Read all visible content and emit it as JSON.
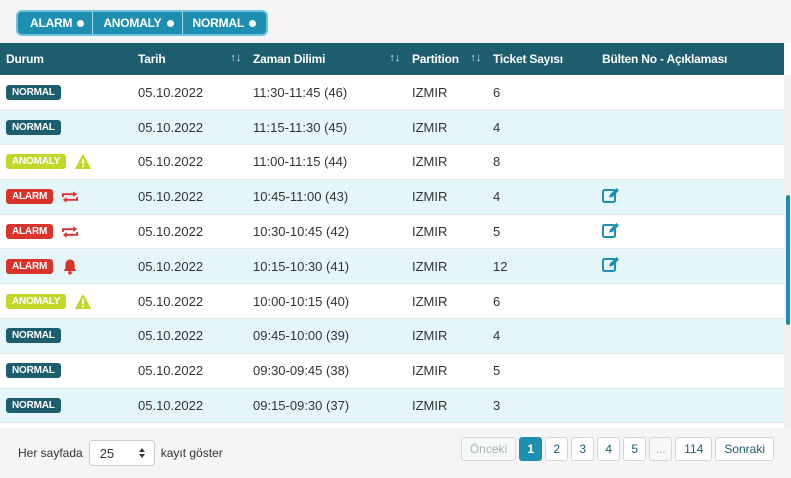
{
  "filters": [
    {
      "label": "ALARM"
    },
    {
      "label": "ANOMALY"
    },
    {
      "label": "NORMAL"
    }
  ],
  "table": {
    "columns": [
      "Durum",
      "Tarih",
      "Zaman Dilimi",
      "Partition",
      "Ticket Sayısı",
      "Bülten No - Açıklaması"
    ],
    "sort_glyph": "↑↓",
    "rows": [
      {
        "status": "NORMAL",
        "status_icon": "",
        "date": "05.10.2022",
        "slot": "11:30-11:45 (46)",
        "partition": "IZMIR",
        "tickets": "6",
        "edit": false
      },
      {
        "status": "NORMAL",
        "status_icon": "",
        "date": "05.10.2022",
        "slot": "11:15-11:30 (45)",
        "partition": "IZMIR",
        "tickets": "4",
        "edit": false
      },
      {
        "status": "ANOMALY",
        "status_icon": "warning-icon",
        "date": "05.10.2022",
        "slot": "11:00-11:15 (44)",
        "partition": "IZMIR",
        "tickets": "8",
        "edit": false
      },
      {
        "status": "ALARM",
        "status_icon": "repeat-icon",
        "date": "05.10.2022",
        "slot": "10:45-11:00 (43)",
        "partition": "IZMIR",
        "tickets": "4",
        "edit": true
      },
      {
        "status": "ALARM",
        "status_icon": "repeat-icon",
        "date": "05.10.2022",
        "slot": "10:30-10:45 (42)",
        "partition": "IZMIR",
        "tickets": "5",
        "edit": true
      },
      {
        "status": "ALARM",
        "status_icon": "bell-icon",
        "date": "05.10.2022",
        "slot": "10:15-10:30 (41)",
        "partition": "IZMIR",
        "tickets": "12",
        "edit": true
      },
      {
        "status": "ANOMALY",
        "status_icon": "warning-icon",
        "date": "05.10.2022",
        "slot": "10:00-10:15 (40)",
        "partition": "IZMIR",
        "tickets": "6",
        "edit": false
      },
      {
        "status": "NORMAL",
        "status_icon": "",
        "date": "05.10.2022",
        "slot": "09:45-10:00 (39)",
        "partition": "IZMIR",
        "tickets": "4",
        "edit": false
      },
      {
        "status": "NORMAL",
        "status_icon": "",
        "date": "05.10.2022",
        "slot": "09:30-09:45 (38)",
        "partition": "IZMIR",
        "tickets": "5",
        "edit": false
      },
      {
        "status": "NORMAL",
        "status_icon": "",
        "date": "05.10.2022",
        "slot": "09:15-09:30 (37)",
        "partition": "IZMIR",
        "tickets": "3",
        "edit": false
      }
    ]
  },
  "footer": {
    "per_page_prefix": "Her sayfada",
    "per_page_value": "25",
    "per_page_suffix": "kayıt göster",
    "pagination": {
      "prev": "Önceki",
      "pages": [
        "1",
        "2",
        "3",
        "4",
        "5"
      ],
      "ellipsis": "...",
      "last": "114",
      "next": "Sonraki",
      "current": "1"
    }
  },
  "colors": {
    "header_bg": "#1d5e6e",
    "accent": "#1e8fb0",
    "alarm": "#d9342b",
    "anomaly": "#c3d72a",
    "normal": "#1d5e6e",
    "edit_icon": "#1e8fb0"
  }
}
